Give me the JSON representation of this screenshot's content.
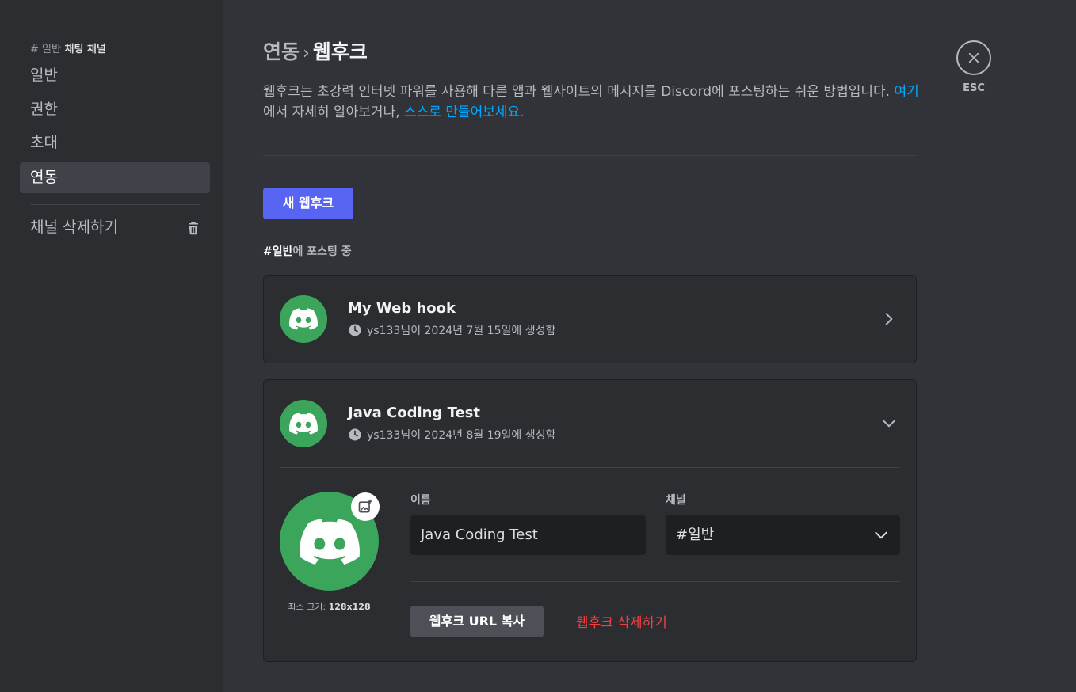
{
  "sidebar": {
    "header_hash": "# 일반",
    "header_label": "채팅 채널",
    "items": [
      {
        "label": "일반"
      },
      {
        "label": "권한"
      },
      {
        "label": "초대"
      },
      {
        "label": "연동"
      }
    ],
    "delete_channel": "채널 삭제하기"
  },
  "header": {
    "breadcrumb_parent": "연동",
    "breadcrumb_sep": "›",
    "breadcrumb_current": "웹후크",
    "esc_label": "ESC"
  },
  "description": {
    "text_before": "웹후크는 초강력 인터넷 파워를 사용해 다른 앱과 웹사이트의 메시지를 Discord에 포스팅하는 쉬운 방법입니다. ",
    "link1": "여기",
    "text_middle": "에서 자세히 알아보거나, ",
    "link2": "스스로 만들어보세요."
  },
  "new_webhook_button": "새 웹후크",
  "posting": {
    "channel": "#일반",
    "suffix": "에 포스팅 중"
  },
  "webhooks": [
    {
      "name": "My Web hook",
      "creator": "ys133",
      "meta": "님이 2024년 7월 15일에 생성함",
      "expanded": false
    },
    {
      "name": "Java Coding Test",
      "creator": "ys133",
      "meta": "님이 2024년 8월 19일에 생성함",
      "expanded": true
    }
  ],
  "editor": {
    "min_size_label": "최소 크기: ",
    "min_size_value": "128x128",
    "name_label": "이름",
    "name_value": "Java Coding Test",
    "channel_label": "채널",
    "channel_value": "#일반",
    "copy_url_button": "웹후크 URL 복사",
    "delete_webhook": "웹후크 삭제하기"
  },
  "colors": {
    "accent": "#5865f2",
    "avatar_green": "#3ba55c",
    "danger": "#f23f42",
    "link": "#00a8fc"
  }
}
